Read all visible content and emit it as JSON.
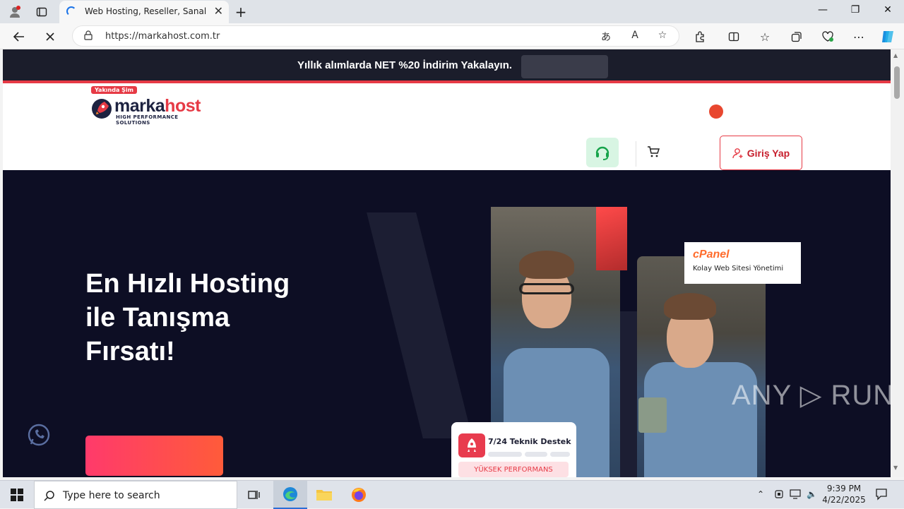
{
  "browser": {
    "tab_title": "Web Hosting, Reseller, Sanal ve F",
    "url": "https://markahost.com.tr",
    "new_tab_symbol": "+",
    "close_symbol": "✕"
  },
  "page": {
    "promo_text": "Yıllık alımlarda NET %20 İndirim Yakalayın.",
    "logo": {
      "badge": "Yakında Şim",
      "word_marka": "marka",
      "word_host": "host",
      "tagline": "HIGH PERFORMANCE SOLUTIONS"
    },
    "login_label": "Giriş Yap",
    "hero_title_lines": [
      "En Hızlı Hosting",
      "ile Tanışma",
      "Fırsatı!"
    ],
    "cpanel_logo": "cPanel",
    "cpanel_text": "Kolay Web Sitesi Yönetimi",
    "support_card_title": "7/24 Teknik Destek",
    "support_card_pill": "YÜKSEK PERFORMANS",
    "watermark": "ANY ▷ RUN"
  },
  "taskbar": {
    "search_placeholder": "Type here to search",
    "time": "9:39 PM",
    "date": "4/22/2025"
  },
  "colors": {
    "accent_red": "#e63a45",
    "hero_bg": "#0d0e24",
    "promo_bg": "#1b1d2b",
    "support_green": "#d8f5e3"
  }
}
